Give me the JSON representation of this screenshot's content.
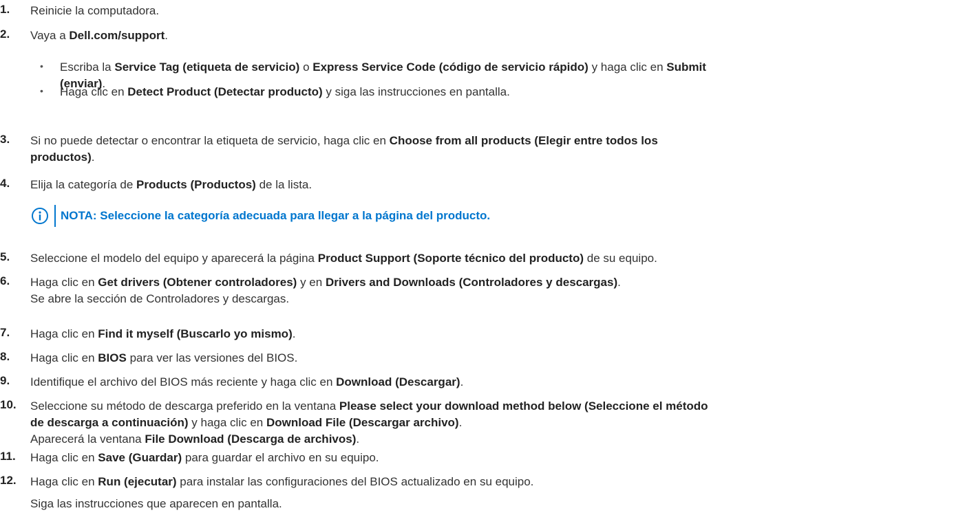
{
  "steps": [
    {
      "num": "1.",
      "lines": [
        [
          {
            "t": "Reinicie la computadora."
          }
        ]
      ]
    },
    {
      "num": "2.",
      "lines": [
        [
          {
            "t": "Vaya a "
          },
          {
            "t": "Dell.com/support",
            "b": true
          },
          {
            "t": "."
          }
        ]
      ]
    },
    {
      "num": "3.",
      "lines": [
        [
          {
            "t": "Si no puede detectar o encontrar la etiqueta de servicio, haga clic en "
          },
          {
            "t": "Choose from all products (Elegir entre todos los",
            "b": true
          }
        ],
        [
          {
            "t": "productos)",
            "b": true
          },
          {
            "t": "."
          }
        ]
      ]
    },
    {
      "num": "4.",
      "lines": [
        [
          {
            "t": "Elija la categoría de "
          },
          {
            "t": "Products (Productos)",
            "b": true
          },
          {
            "t": " de la lista."
          }
        ]
      ]
    },
    {
      "num": "5.",
      "lines": [
        [
          {
            "t": "Seleccione el modelo del equipo y aparecerá la página "
          },
          {
            "t": "Product Support (Soporte técnico del producto)",
            "b": true
          },
          {
            "t": " de su equipo."
          }
        ]
      ]
    },
    {
      "num": "6.",
      "lines": [
        [
          {
            "t": "Haga clic en "
          },
          {
            "t": "Get drivers (Obtener controladores)",
            "b": true
          },
          {
            "t": " y en "
          },
          {
            "t": "Drivers and Downloads (Controladores y descargas)",
            "b": true
          },
          {
            "t": "."
          }
        ],
        [
          {
            "t": "Se abre la sección de Controladores y descargas."
          }
        ]
      ]
    },
    {
      "num": "7.",
      "lines": [
        [
          {
            "t": "Haga clic en "
          },
          {
            "t": "Find it myself (Buscarlo yo mismo)",
            "b": true
          },
          {
            "t": "."
          }
        ]
      ]
    },
    {
      "num": "8.",
      "lines": [
        [
          {
            "t": "Haga clic en "
          },
          {
            "t": "BIOS",
            "b": true
          },
          {
            "t": " para ver las versiones del BIOS."
          }
        ]
      ]
    },
    {
      "num": "9.",
      "lines": [
        [
          {
            "t": "Identifique el archivo del BIOS más reciente y haga clic en "
          },
          {
            "t": "Download (Descargar)",
            "b": true
          },
          {
            "t": "."
          }
        ]
      ]
    },
    {
      "num": "10.",
      "lines": [
        [
          {
            "t": "Seleccione su método de descarga preferido en la ventana "
          },
          {
            "t": "Please select your download method below (Seleccione el método",
            "b": true
          }
        ],
        [
          {
            "t": "de descarga a continuación)",
            "b": true
          },
          {
            "t": " y haga clic en "
          },
          {
            "t": "Download File (Descargar archivo)",
            "b": true
          },
          {
            "t": "."
          }
        ],
        [
          {
            "t": "Aparecerá la ventana "
          },
          {
            "t": "File Download (Descarga de archivos)",
            "b": true
          },
          {
            "t": "."
          }
        ]
      ]
    },
    {
      "num": "11.",
      "lines": [
        [
          {
            "t": "Haga clic en "
          },
          {
            "t": "Save (Guardar)",
            "b": true
          },
          {
            "t": " para guardar el archivo en su equipo."
          }
        ]
      ]
    },
    {
      "num": "12.",
      "lines": [
        [
          {
            "t": "Haga clic en "
          },
          {
            "t": "Run (ejecutar)",
            "b": true
          },
          {
            "t": " para instalar las configuraciones del BIOS actualizado en su equipo."
          }
        ]
      ]
    }
  ],
  "substeps": [
    {
      "bullet": "•",
      "lines": [
        [
          {
            "t": "Escriba la "
          },
          {
            "t": "Service Tag (etiqueta de servicio)",
            "b": true
          },
          {
            "t": " o "
          },
          {
            "t": "Express Service Code (código de servicio rápido)",
            "b": true
          },
          {
            "t": " y haga clic en "
          },
          {
            "t": "Submit",
            "b": true
          }
        ],
        [
          {
            "t": "(enviar)",
            "b": true
          },
          {
            "t": "."
          }
        ]
      ]
    },
    {
      "bullet": "•",
      "lines": [
        [
          {
            "t": "Haga clic en "
          },
          {
            "t": "Detect Product (Detectar producto)",
            "b": true
          },
          {
            "t": " y siga las instrucciones en pantalla."
          }
        ]
      ]
    }
  ],
  "note": {
    "icon": "info-icon",
    "text": "NOTA: Seleccione la categoría adecuada para llegar a la página del producto.",
    "color": "#0076ce"
  },
  "final_text": "Siga las instrucciones que aparecen en pantalla."
}
